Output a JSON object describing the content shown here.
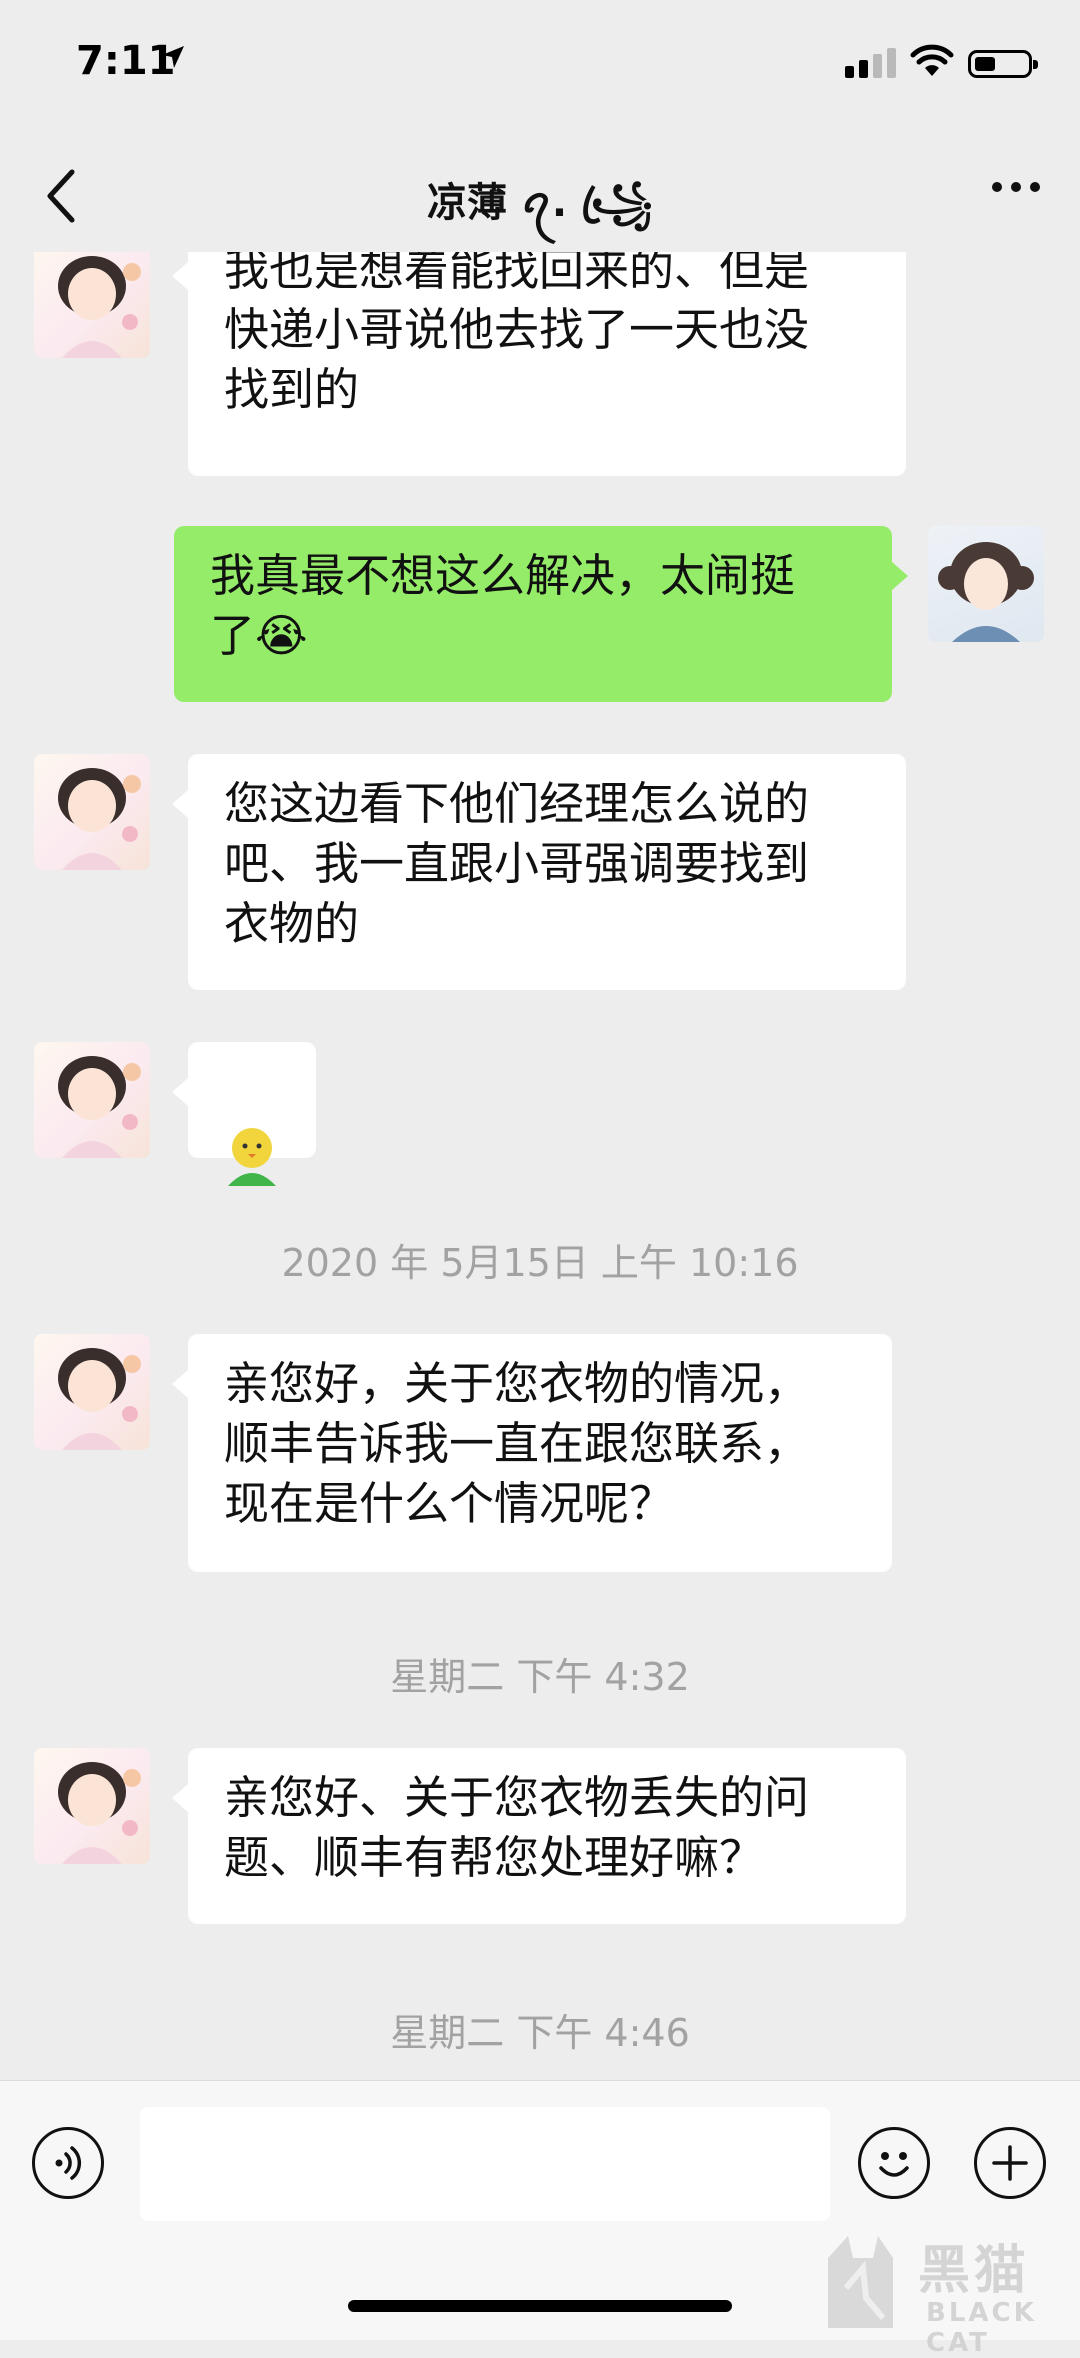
{
  "status_bar": {
    "time": "7:11"
  },
  "header": {
    "title": "凉薄 ꪖ. ꧁ꦿ"
  },
  "messages": [
    {
      "side": "in",
      "text": "我也是想着能找回来的、但是\n快递小哥说他去找了一天也没\n找到的"
    },
    {
      "side": "out",
      "text": "我真最不想这么解决，太闹挺\n了😭"
    },
    {
      "side": "in",
      "text": "您这边看下他们经理怎么说的\n吧、我一直跟小哥强调要找到\n衣物的"
    },
    {
      "side": "in",
      "text": "",
      "sticker": "chick-emoji"
    },
    {
      "timestamp": "2020 年 5月15日 上午 10:16"
    },
    {
      "side": "in",
      "text": "亲您好，关于您衣物的情况，\n顺丰告诉我一直在跟您联系，\n现在是什么个情况呢？"
    },
    {
      "timestamp": "星期二 下午 4:32"
    },
    {
      "side": "in",
      "text": "亲您好、关于您衣物丢失的问\n题、顺丰有帮您处理好嘛？"
    },
    {
      "timestamp": "星期二 下午 4:46"
    }
  ],
  "input_bar": {
    "placeholder": ""
  },
  "watermark": {
    "cn": "黑猫",
    "en": "BLACK CAT"
  },
  "colors": {
    "background": "#ededed",
    "bubble_in": "#ffffff",
    "bubble_out": "#95ec69",
    "timestamp": "#a2a2a2"
  }
}
